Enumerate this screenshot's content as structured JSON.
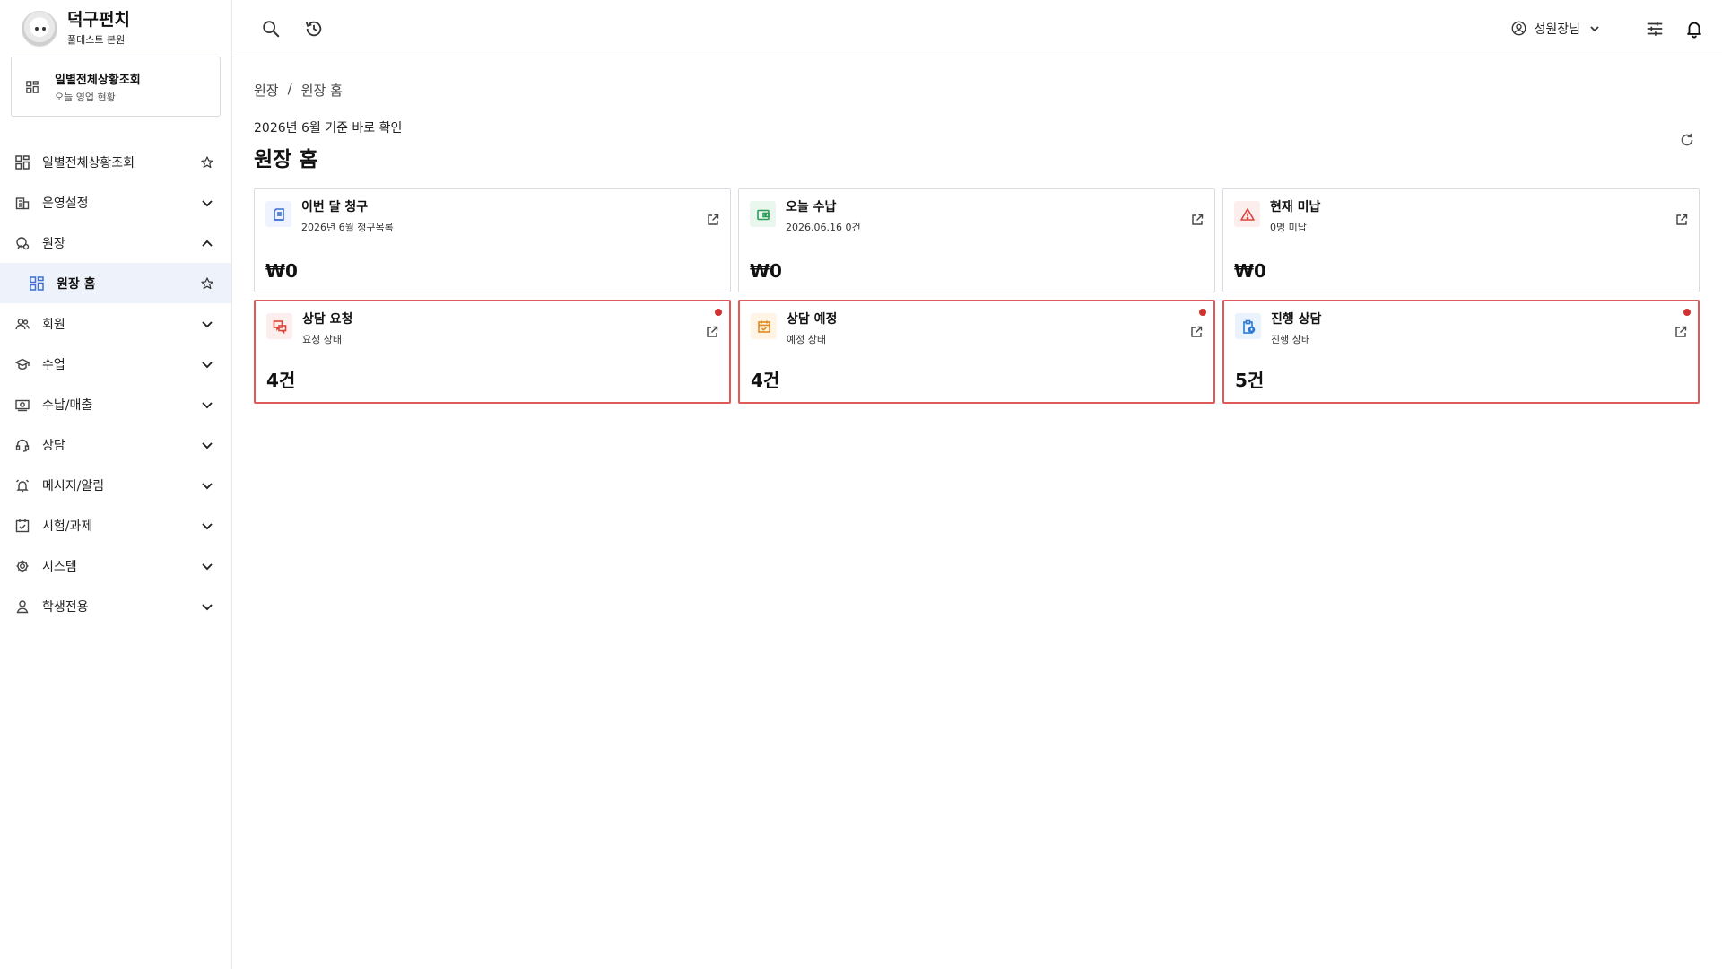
{
  "brand": {
    "name": "덕구펀치",
    "branch": "풀테스트 본원"
  },
  "quick": {
    "title": "일별전체상황조회",
    "subtitle": "오늘 영업 현황"
  },
  "nav": [
    {
      "label": "일별전체상황조회",
      "icon": "dashboard-icon",
      "trail": "star"
    },
    {
      "label": "운영설정",
      "icon": "building-icon",
      "trail": "chevron-down"
    },
    {
      "label": "원장",
      "icon": "principal-icon",
      "trail": "chevron-up"
    },
    {
      "label": "원장 홈",
      "icon": "dashboard-icon",
      "trail": "star",
      "active": true
    },
    {
      "label": "회원",
      "icon": "users-icon",
      "trail": "chevron-down"
    },
    {
      "label": "수업",
      "icon": "graduation-icon",
      "trail": "chevron-down"
    },
    {
      "label": "수납/매출",
      "icon": "money-icon",
      "trail": "chevron-down"
    },
    {
      "label": "상담",
      "icon": "headset-icon",
      "trail": "chevron-down"
    },
    {
      "label": "메시지/알림",
      "icon": "alarm-icon",
      "trail": "chevron-down"
    },
    {
      "label": "시험/과제",
      "icon": "checkbox-icon",
      "trail": "chevron-down"
    },
    {
      "label": "시스템",
      "icon": "gear-icon",
      "trail": "chevron-down"
    },
    {
      "label": "학생전용",
      "icon": "person-icon",
      "trail": "chevron-down"
    }
  ],
  "topbar": {
    "user": "성원장님"
  },
  "breadcrumb": {
    "parent": "원장",
    "sep": "/",
    "current": "원장 홈"
  },
  "page": {
    "subtitle": "2026년 6월 기준 바로 확인",
    "title": "원장 홈"
  },
  "cards": [
    {
      "title": "이번 달 청구",
      "sub": "2026년 6월 청구목록",
      "value": "₩0",
      "icon": "invoice-icon",
      "color": "#3f6fd1",
      "bg": "#eef3ff",
      "alert": false
    },
    {
      "title": "오늘 수납",
      "sub": "2026.06.16 0건",
      "value": "₩0",
      "icon": "wallet-icon",
      "color": "#2e9d5a",
      "bg": "#e9f7ef",
      "alert": false
    },
    {
      "title": "현재 미납",
      "sub": "0명 미납",
      "value": "₩0",
      "icon": "warning-icon",
      "color": "#d9453b",
      "bg": "#fdeeee",
      "alert": false
    },
    {
      "title": "상담 요청",
      "sub": "요청 상태",
      "value": "4건",
      "icon": "chat-icon",
      "color": "#d9453b",
      "bg": "#fdeeee",
      "alert": true
    },
    {
      "title": "상담 예정",
      "sub": "예정 상태",
      "value": "4건",
      "icon": "calendar-check-icon",
      "color": "#e08a1e",
      "bg": "#fff4e6",
      "alert": true
    },
    {
      "title": "진행 상담",
      "sub": "진행 상태",
      "value": "5건",
      "icon": "clipboard-icon",
      "color": "#2b7bd6",
      "bg": "#eaf3fd",
      "alert": true
    }
  ]
}
